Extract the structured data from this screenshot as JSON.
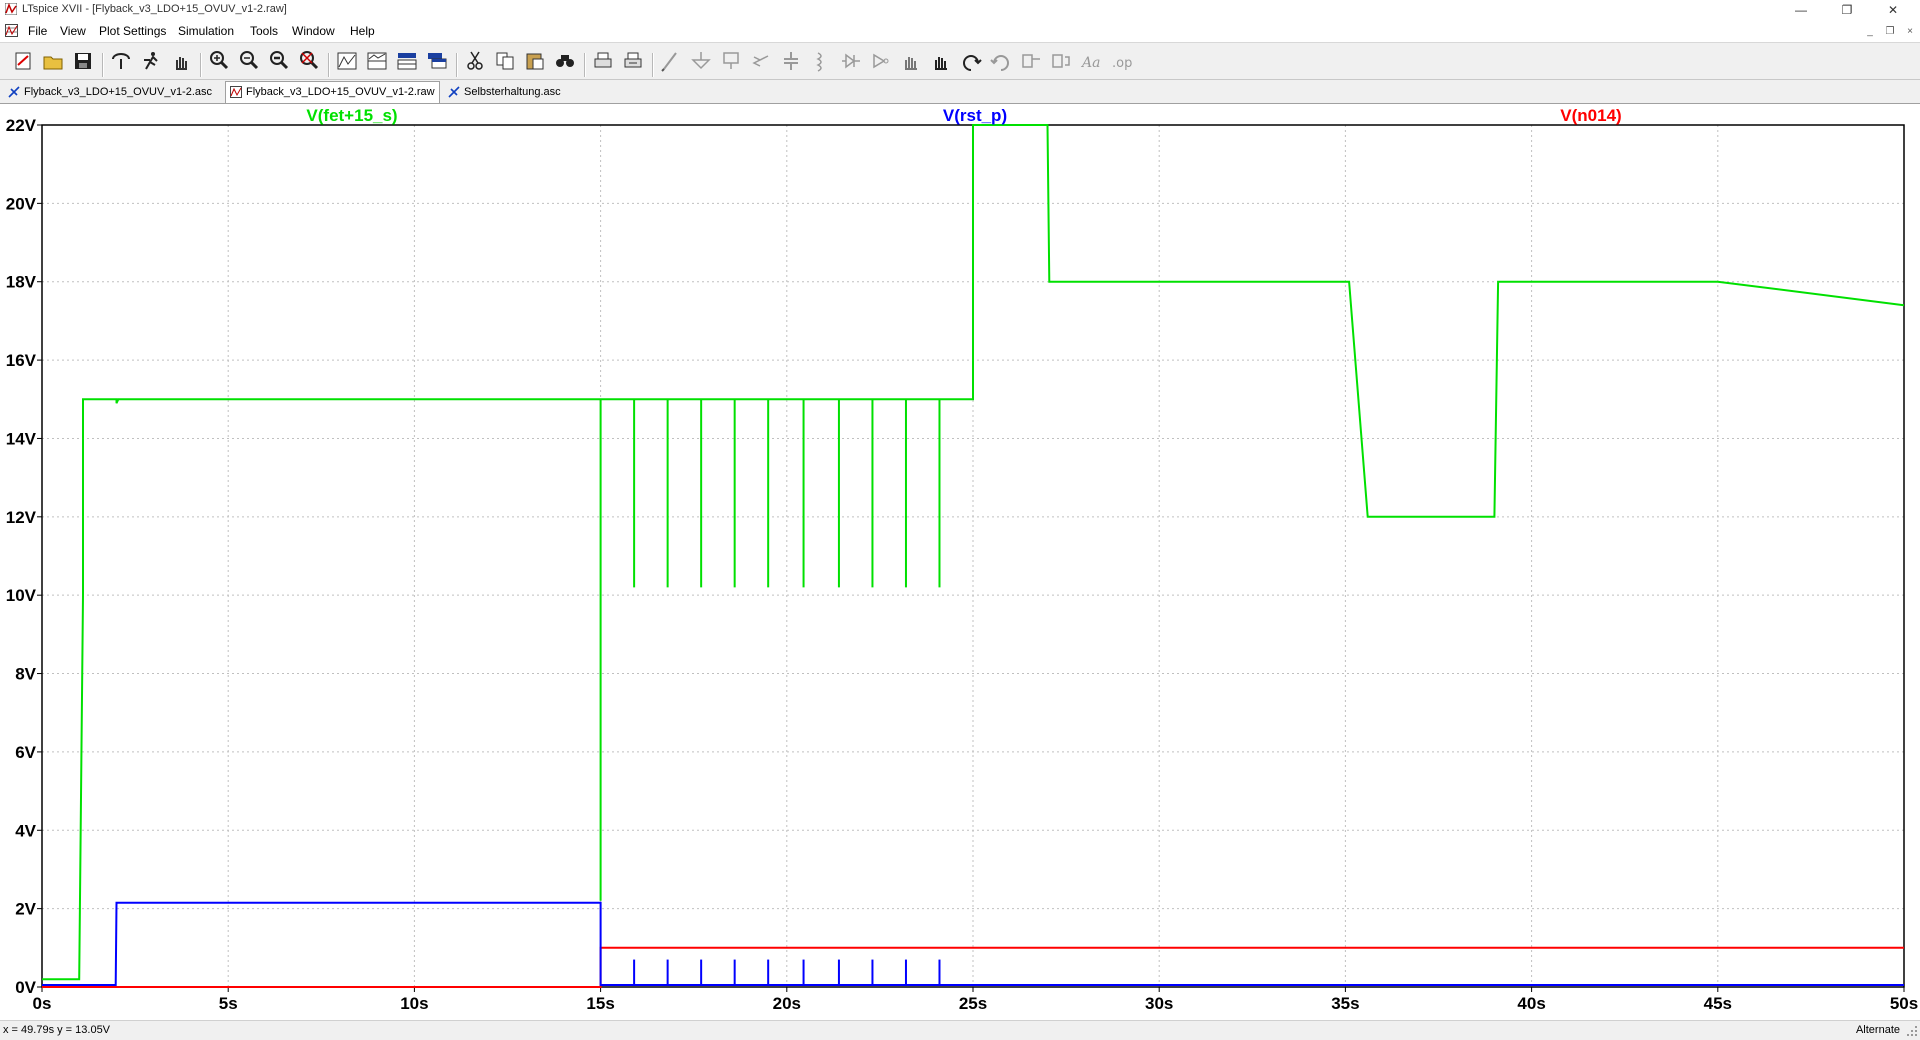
{
  "window": {
    "title": "LTspice XVII - [Flyback_v3_LDO+15_OVUV_v1-2.raw]",
    "minimize": "—",
    "restore": "❐",
    "close": "✕"
  },
  "menu": [
    {
      "label": "File"
    },
    {
      "label": "View"
    },
    {
      "label": "Plot Settings"
    },
    {
      "label": "Simulation"
    },
    {
      "label": "Tools"
    },
    {
      "label": "Window"
    },
    {
      "label": "Help"
    }
  ],
  "toolbar": {
    "icons": [
      "new-schematic-icon",
      "open-icon",
      "save-icon",
      "control-panel-icon",
      "run-icon",
      "pan-icon",
      "zoom-in-icon",
      "zoom-out-icon",
      "zoom-back-icon",
      "zoom-fit-icon",
      "autorange-icon",
      "plot-pane-icon",
      "add-pane-icon",
      "delete-pane-icon",
      "cut-icon",
      "copy-icon",
      "paste-icon",
      "find-icon",
      "print-icon",
      "print-preview-icon",
      "wire-icon",
      "ground-icon",
      "label-icon",
      "resistor-icon",
      "capacitor-icon",
      "inductor-icon",
      "diode-icon",
      "component-icon",
      "move-icon",
      "drag-icon",
      "undo-icon",
      "redo-icon",
      "rotate-icon",
      "mirror-icon",
      "text-icon",
      "spice-directive-icon"
    ]
  },
  "tabs": [
    {
      "label": "Flyback_v3_LDO+15_OVUV_v1-2.asc",
      "icon": "schematic-icon",
      "active": false
    },
    {
      "label": "Flyback_v3_LDO+15_OVUV_v1-2.raw",
      "icon": "waveform-icon",
      "active": true
    },
    {
      "label": "Selbsterhaltung.asc",
      "icon": "schematic-icon",
      "active": false
    }
  ],
  "chart_data": {
    "type": "line",
    "xlim": [
      0,
      50
    ],
    "ylim": [
      0,
      22
    ],
    "x_ticks": [
      "0s",
      "5s",
      "10s",
      "15s",
      "20s",
      "25s",
      "30s",
      "35s",
      "40s",
      "45s",
      "50s"
    ],
    "y_ticks": [
      "0V",
      "2V",
      "4V",
      "6V",
      "8V",
      "10V",
      "12V",
      "14V",
      "16V",
      "18V",
      "20V",
      "22V"
    ],
    "grid": true,
    "legend_placement": "top",
    "series": [
      {
        "name": "V(fet+15_s)",
        "color": "#00e000",
        "points": [
          [
            0,
            0.2
          ],
          [
            1.0,
            0.2
          ],
          [
            1.1,
            10
          ],
          [
            1.1,
            15
          ],
          [
            2.0,
            15
          ],
          [
            2.0,
            14.9
          ],
          [
            2.05,
            15
          ],
          [
            15.0,
            15
          ],
          [
            15.0,
            2.2
          ],
          [
            15.0,
            15
          ],
          [
            25.0,
            15
          ],
          [
            25.0,
            22
          ],
          [
            27.0,
            22
          ],
          [
            27.05,
            18
          ],
          [
            35.1,
            18
          ],
          [
            35.6,
            12
          ],
          [
            39.0,
            12
          ],
          [
            39.1,
            18
          ],
          [
            45.0,
            18
          ],
          [
            50,
            17.4
          ]
        ],
        "dips": {
          "x": [
            15.9,
            16.8,
            17.7,
            18.6,
            19.5,
            20.45,
            21.4,
            22.3,
            23.2,
            24.1
          ],
          "from": 15,
          "to": 10.2
        }
      },
      {
        "name": "V(rst_p)",
        "color": "#0000ff",
        "points": [
          [
            0,
            0.05
          ],
          [
            1.98,
            0.05
          ],
          [
            2.0,
            2.15
          ],
          [
            15.0,
            2.15
          ],
          [
            15.0,
            0.05
          ],
          [
            50,
            0.05
          ]
        ],
        "pulses": {
          "x": [
            15.9,
            16.8,
            17.7,
            18.6,
            19.5,
            20.45,
            21.4,
            22.3,
            23.2,
            24.1
          ],
          "from": 0.05,
          "to": 0.7
        }
      },
      {
        "name": "V(n014)",
        "color": "#ff0000",
        "points": [
          [
            0,
            0
          ],
          [
            15.0,
            0
          ],
          [
            15.0,
            1.0
          ],
          [
            50,
            1.0
          ]
        ]
      }
    ]
  },
  "status": {
    "coords": "x = 49.79s    y = 13.05V",
    "mode": "Alternate"
  }
}
